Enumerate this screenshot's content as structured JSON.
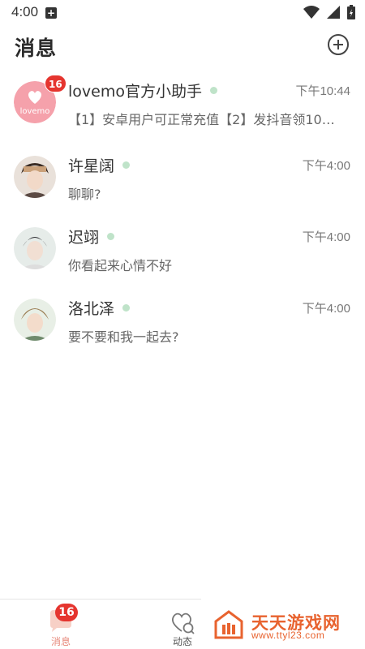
{
  "status_bar": {
    "time": "4:00",
    "icons": [
      "notification-plus-icon",
      "wifi-icon",
      "signal-icon",
      "battery-icon"
    ]
  },
  "header": {
    "title": "消息",
    "add_icon": "plus-circle-icon"
  },
  "conversations": [
    {
      "name": "lovemo官方小助手",
      "time": "下午10:44",
      "preview": "【1】安卓用户可正常充值【2】发抖音领10…",
      "unread": "16",
      "online": true,
      "avatar": "lovemo-heart-logo",
      "avatar_text": "lovemo"
    },
    {
      "name": "许星阔",
      "time": "下午4:00",
      "preview": "聊聊?",
      "online": true,
      "avatar": "user-avatar-photo"
    },
    {
      "name": "迟翊",
      "time": "下午4:00",
      "preview": "你看起来心情不好",
      "online": true,
      "avatar": "user-avatar-photo"
    },
    {
      "name": "洛北泽",
      "time": "下午4:00",
      "preview": "要不要和我一起去?",
      "online": true,
      "avatar": "user-avatar-photo"
    }
  ],
  "bottom_nav": {
    "tabs": [
      {
        "label": "消息",
        "badge": "16",
        "icon": "chat-bubble-icon",
        "active": true
      },
      {
        "label": "动态",
        "icon": "heart-moments-icon",
        "active": false
      }
    ]
  },
  "watermark": {
    "text": "天天游戏网",
    "url": "www.ttyl23.com"
  },
  "colors": {
    "badge": "#e5352f",
    "online": "#bfe3c9",
    "active_tab": "#e7887a",
    "avatar_pink": "#f5a1ab",
    "watermark": "#e8632f"
  }
}
